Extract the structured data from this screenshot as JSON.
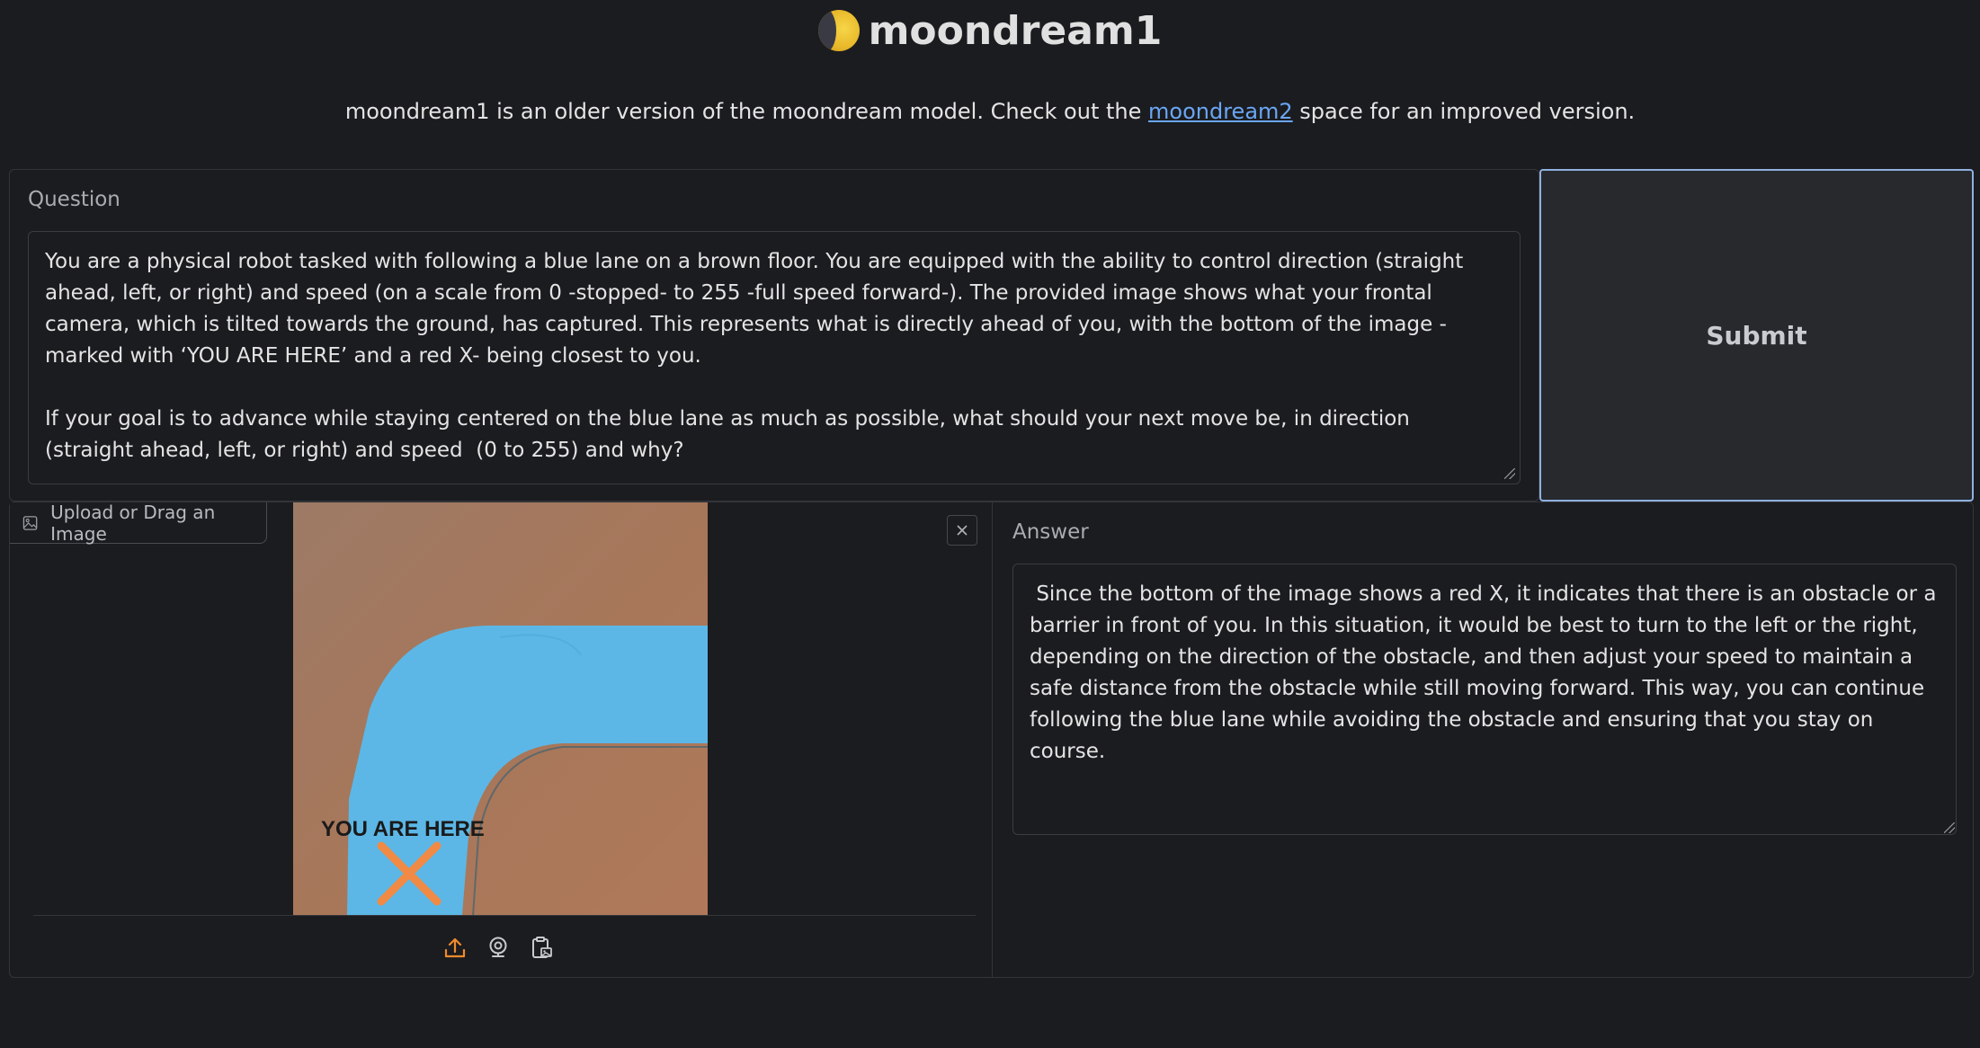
{
  "app": {
    "title": "moondream1",
    "subtitle_before": "moondream1 is an older version of the moondream model. Check out the ",
    "subtitle_link": "moondream2",
    "subtitle_after": " space for an improved version."
  },
  "question": {
    "label": "Question",
    "value": "You are a physical robot tasked with following a blue lane on a brown floor. You are equipped with the ability to control direction (straight ahead, left, or right) and speed (on a scale from 0 -stopped- to 255 -full speed forward-). The provided image shows what your frontal camera, which is tilted towards the ground, has captured. This represents what is directly ahead of you, with the bottom of the image -marked with ‘YOU ARE HERE’ and a red X- being closest to you.\n\nIf your goal is to advance while staying centered on the blue lane as much as possible, what should your next move be, in direction (straight ahead, left, or right) and speed  (0 to 255) and why?"
  },
  "submit": {
    "label": "Submit"
  },
  "image_input": {
    "label": "Upload or Drag an Image",
    "image_text": "YOU ARE HERE",
    "tools": [
      "upload-icon",
      "webcam-icon",
      "clipboard-icon"
    ]
  },
  "answer": {
    "label": "Answer",
    "value": " Since the bottom of the image shows a red X, it indicates that there is an obstacle or a barrier in front of you. In this situation, it would be best to turn to the left or the right, depending on the direction of the obstacle, and then adjust your speed to maintain a safe distance from the obstacle while still moving forward. This way, you can continue following the blue lane while avoiding the obstacle and ensuring that you stay on course."
  },
  "colors": {
    "background": "#1b1c1f",
    "accent_border": "#8fb0e0",
    "link": "#6aa6f5",
    "tool_orange": "#f08a2c",
    "floor_brown": "#a8775a",
    "lane_blue": "#5cb7e6"
  }
}
